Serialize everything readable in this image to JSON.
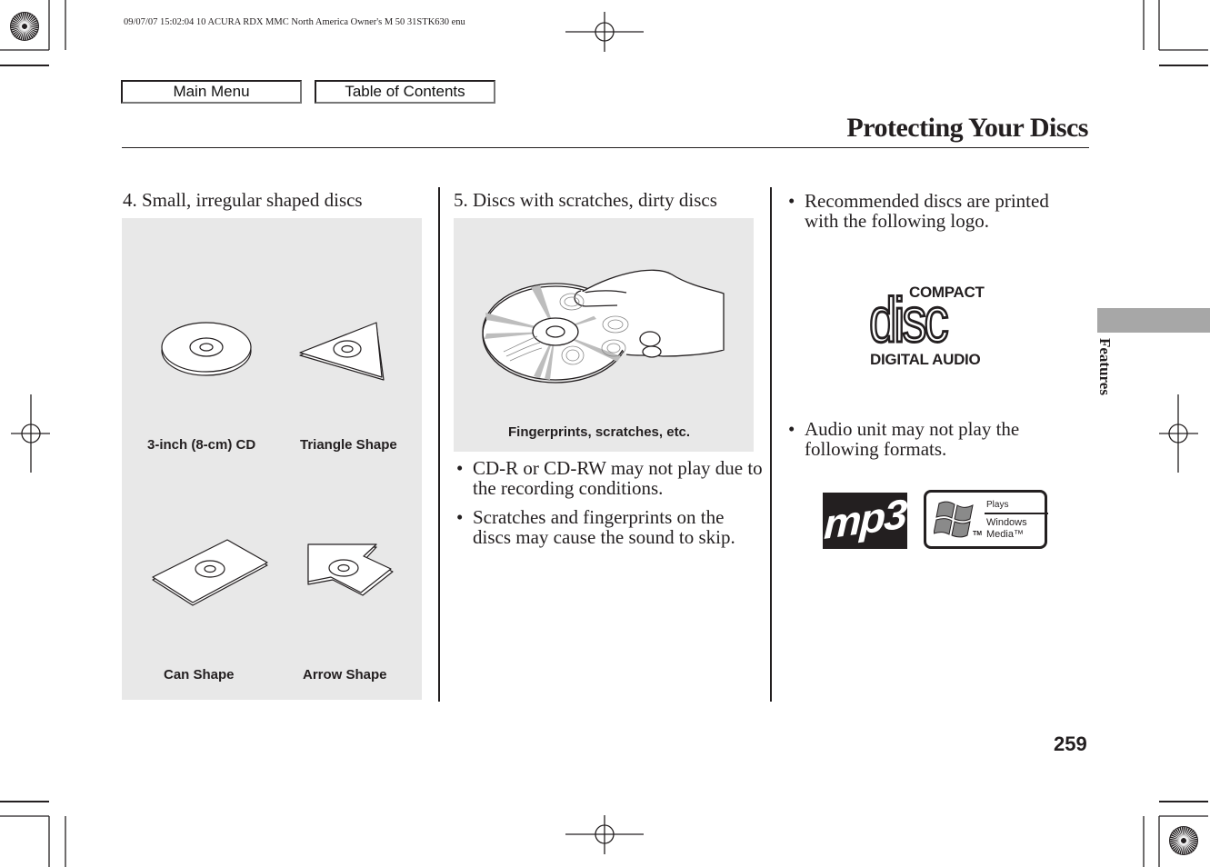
{
  "print_slug": "09/07/07 15:02:04   10 ACURA RDX MMC North America Owner's M 50 31STK630 enu",
  "nav": {
    "main_menu": "Main Menu",
    "table_of_contents": "Table of Contents"
  },
  "page": {
    "title": "Protecting Your Discs",
    "section_tab": "Features",
    "section_tab_color": "#a7a7a7",
    "page_number": "259"
  },
  "columns": [
    {
      "heading": "4. Small, irregular shaped discs",
      "figure_captions": [
        "3-inch (8-cm) CD",
        "Triangle Shape",
        "Can Shape",
        "Arrow Shape"
      ]
    },
    {
      "heading": "5. Discs with scratches, dirty discs",
      "figure_caption": "Fingerprints, scratches, etc.",
      "bullets": [
        "CD-R or CD-RW may not play due to the recording conditions.",
        "Scratches and fingerprints on the discs may cause the sound to skip."
      ]
    },
    {
      "bullets": [
        "Recommended discs are printed with the following logo.",
        "Audio unit may not play the following formats."
      ],
      "cd_logo": {
        "top": "COMPACT",
        "main": "disc",
        "bottom": "DIGITAL AUDIO"
      },
      "format_logos": {
        "mp3": "mp3",
        "wma_line1": "Plays",
        "wma_line2": "Windows",
        "wma_line3": "Media™",
        "wma_tm": "TM"
      }
    }
  ],
  "bullet_glyph": "•",
  "colors": {
    "panel_bg": "#e8e8e8",
    "text": "#231f20"
  }
}
